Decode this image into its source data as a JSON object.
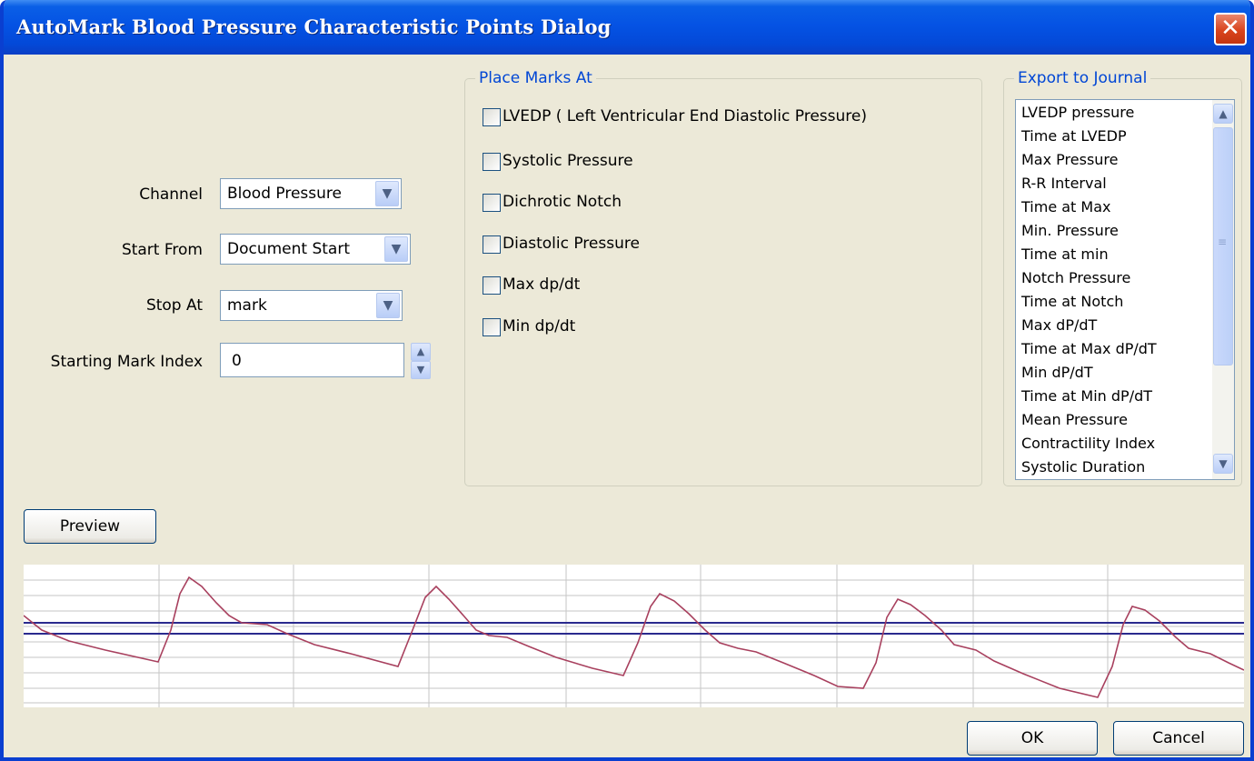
{
  "window": {
    "title": "AutoMark Blood Pressure Characteristic Points Dialog",
    "close_glyph": "✕"
  },
  "settings": {
    "channel_label": "Channel",
    "channel_value": "Blood Pressure",
    "start_label": "Start From",
    "start_value": "Document Start",
    "stop_label": "Stop At",
    "stop_value": "mark",
    "index_label": "Starting Mark Index",
    "index_value": "0"
  },
  "marks": {
    "legend": "Place Marks At",
    "items": [
      {
        "label": "LVEDP ( Left Ventricular End Diastolic Pressure)",
        "checked": false
      },
      {
        "label": "Systolic Pressure",
        "checked": false
      },
      {
        "label": "Dichrotic Notch",
        "checked": false
      },
      {
        "label": "Diastolic Pressure",
        "checked": false
      },
      {
        "label": "Max dp/dt",
        "checked": false
      },
      {
        "label": "Min dp/dt",
        "checked": false
      }
    ]
  },
  "export": {
    "legend": "Export to Journal",
    "items": [
      "LVEDP pressure",
      "Time at LVEDP",
      "Max Pressure",
      "R-R Interval",
      "Time at Max",
      "Min. Pressure",
      "Time at min",
      "Notch Pressure",
      "Time at Notch",
      "Max dP/dT",
      "Time at Max dP/dT",
      "Min dP/dT",
      "Time at Min dP/dT",
      "Mean Pressure",
      "Contractility Index",
      "Systolic Duration"
    ]
  },
  "buttons": {
    "preview": "Preview",
    "ok": "OK",
    "cancel": "Cancel"
  },
  "icons": {
    "dropdown": "chevron-down-icon",
    "spin_up": "spin-up-icon",
    "spin_down": "spin-down-icon",
    "scroll_up": "scroll-up-icon",
    "scroll_down": "scroll-down-icon",
    "close": "close-icon"
  },
  "colors": {
    "title_bar": "#0553e4",
    "close_button": "#d9441d",
    "group_legend": "#0046d5",
    "trace": "#a8405e",
    "threshold_lines": "#2a2a8e",
    "grid": "#c6c6c6"
  }
}
